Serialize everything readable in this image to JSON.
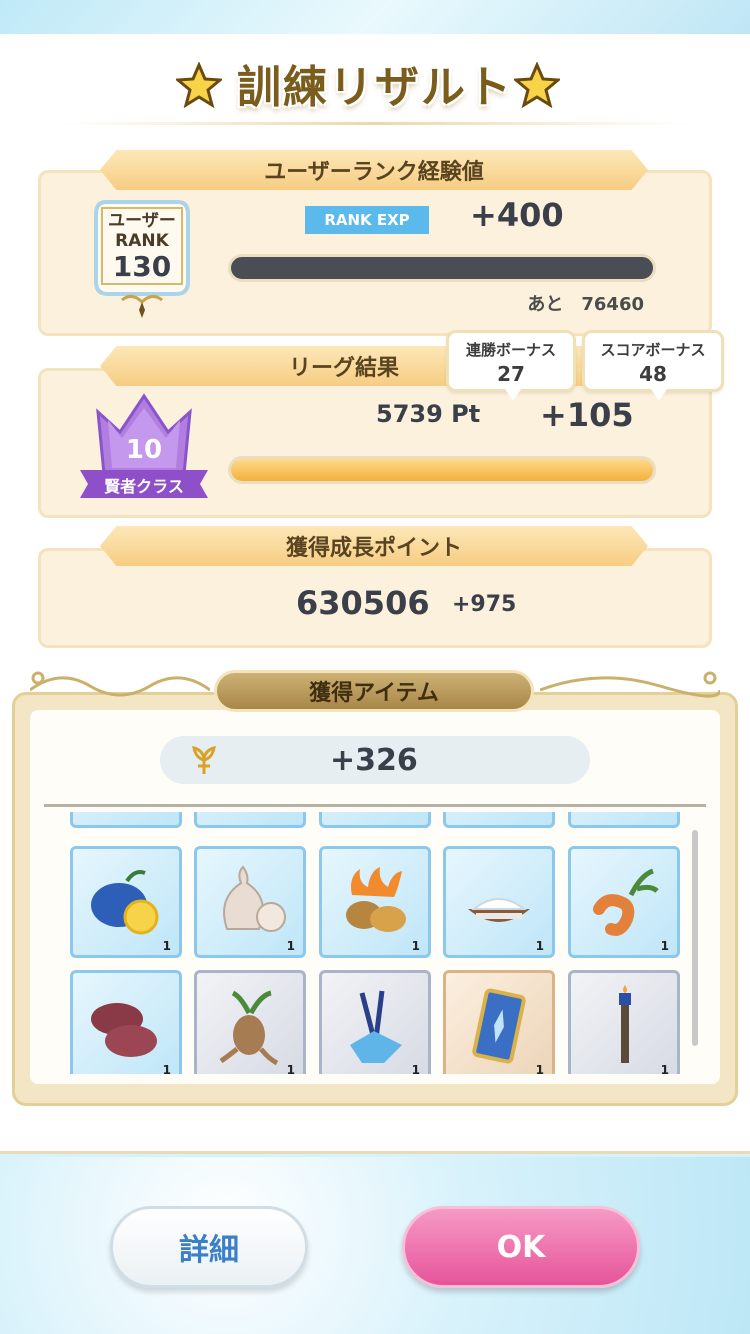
{
  "title": "訓練リザルト",
  "rank_section": {
    "ribbon": "ユーザーランク経験値",
    "badge_line1": "ユーザー",
    "badge_line2": "RANK",
    "rank_value": "130",
    "exp_tag": "RANK EXP",
    "exp_gain": "+400",
    "exp_progress_fraction": 0.0,
    "remain_label": "あと",
    "remain_value": "76460"
  },
  "league_section": {
    "ribbon": "リーグ結果",
    "class_level": "10",
    "class_name": "賢者クラス",
    "points": "5739 Pt",
    "points_gain": "+105",
    "progress_fraction": 1.0,
    "bubble_win": {
      "label": "連勝ボーナス",
      "value": "27"
    },
    "bubble_score": {
      "label": "スコアボーナス",
      "value": "48"
    }
  },
  "growth_section": {
    "ribbon": "獲得成長ポイント",
    "total": "630506",
    "gain": "+975"
  },
  "items_section": {
    "header": "獲得アイテム",
    "money_gain": "+326",
    "items": [
      {
        "name": "lemon-icon",
        "qty": "1"
      },
      {
        "name": "garlic-icon",
        "qty": "1"
      },
      {
        "name": "flaming-potato-icon",
        "qty": "1"
      },
      {
        "name": "salt-bowl-icon",
        "qty": "1"
      },
      {
        "name": "carrot-root-icon",
        "qty": "1"
      },
      {
        "name": "meat-icon",
        "qty": "1"
      },
      {
        "name": "mandrake-icon",
        "qty": "1"
      },
      {
        "name": "crystal-wand-icon",
        "qty": "1"
      },
      {
        "name": "card-icon",
        "qty": "1"
      },
      {
        "name": "candle-staff-icon",
        "qty": "1"
      }
    ]
  },
  "buttons": {
    "detail": "詳細",
    "ok": "OK"
  },
  "colors": {
    "ok_button": "#e6549a",
    "rank_exp_tag": "#5cb9ec",
    "bar_fill": "#f2b13b"
  }
}
